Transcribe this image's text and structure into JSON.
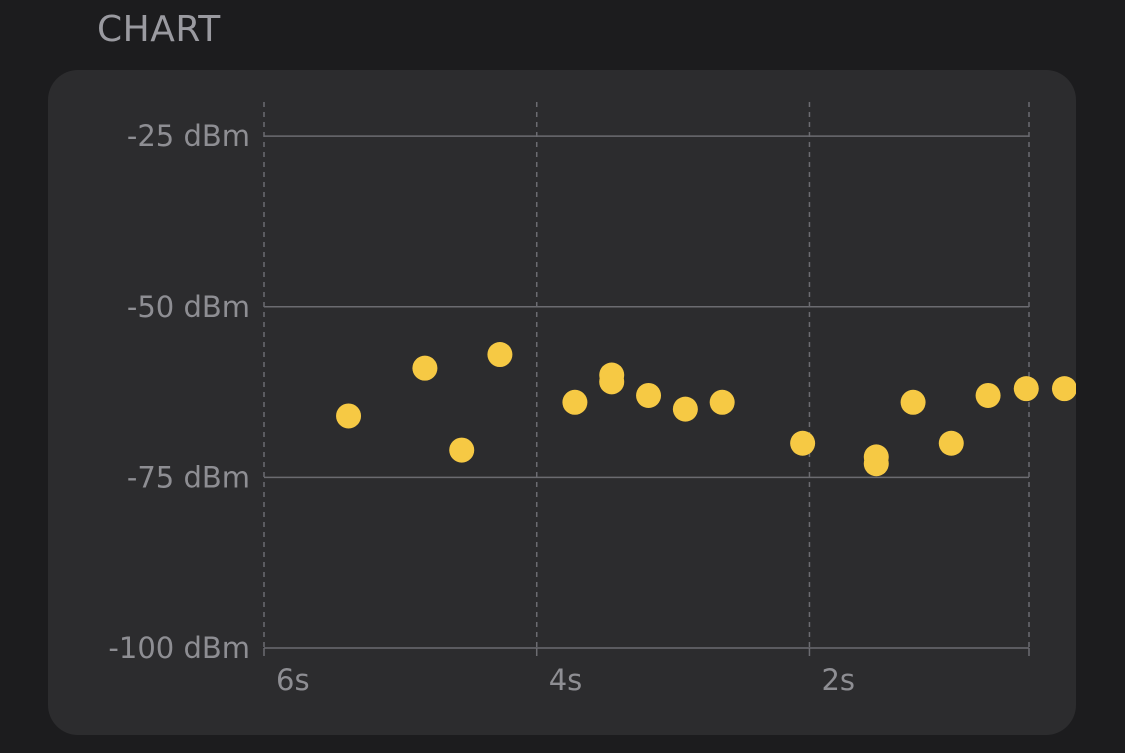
{
  "section": {
    "title": "CHART"
  },
  "colors": {
    "background": "#1c1c1e",
    "card": "#2c2c2e",
    "point": "#f6c944",
    "gridline": "#6b6b70",
    "label": "#8e8e93"
  },
  "chart_data": {
    "type": "scatter",
    "title": "",
    "xlabel": "",
    "ylabel": "",
    "x_unit": "s",
    "y_unit": "dBm",
    "xlim": [
      6,
      0.5
    ],
    "x_reversed": true,
    "ylim": [
      -100,
      -20
    ],
    "x_ticks": [
      {
        "value": 6,
        "label": "6s"
      },
      {
        "value": 4,
        "label": "4s"
      },
      {
        "value": 2,
        "label": "2s"
      }
    ],
    "y_ticks": [
      {
        "value": -25,
        "label": "-25 dBm"
      },
      {
        "value": -50,
        "label": "-50 dBm"
      },
      {
        "value": -75,
        "label": "-75 dBm"
      },
      {
        "value": -100,
        "label": "-100 dBm"
      }
    ],
    "grid": {
      "horizontal": "solid",
      "vertical": "dashed"
    },
    "series": [
      {
        "points": [
          {
            "x": 5.38,
            "y": -66
          },
          {
            "x": 4.82,
            "y": -59
          },
          {
            "x": 4.55,
            "y": -71
          },
          {
            "x": 4.27,
            "y": -57
          },
          {
            "x": 3.72,
            "y": -64
          },
          {
            "x": 3.45,
            "y": -60
          },
          {
            "x": 3.45,
            "y": -61
          },
          {
            "x": 3.18,
            "y": -63
          },
          {
            "x": 2.91,
            "y": -65
          },
          {
            "x": 2.64,
            "y": -64
          },
          {
            "x": 2.05,
            "y": -70
          },
          {
            "x": 1.51,
            "y": -72
          },
          {
            "x": 1.51,
            "y": -73
          },
          {
            "x": 1.24,
            "y": -64
          },
          {
            "x": 0.96,
            "y": -70
          },
          {
            "x": 0.69,
            "y": -63
          },
          {
            "x": 0.41,
            "y": -62
          },
          {
            "x": 0.13,
            "y": -62
          }
        ]
      }
    ]
  }
}
